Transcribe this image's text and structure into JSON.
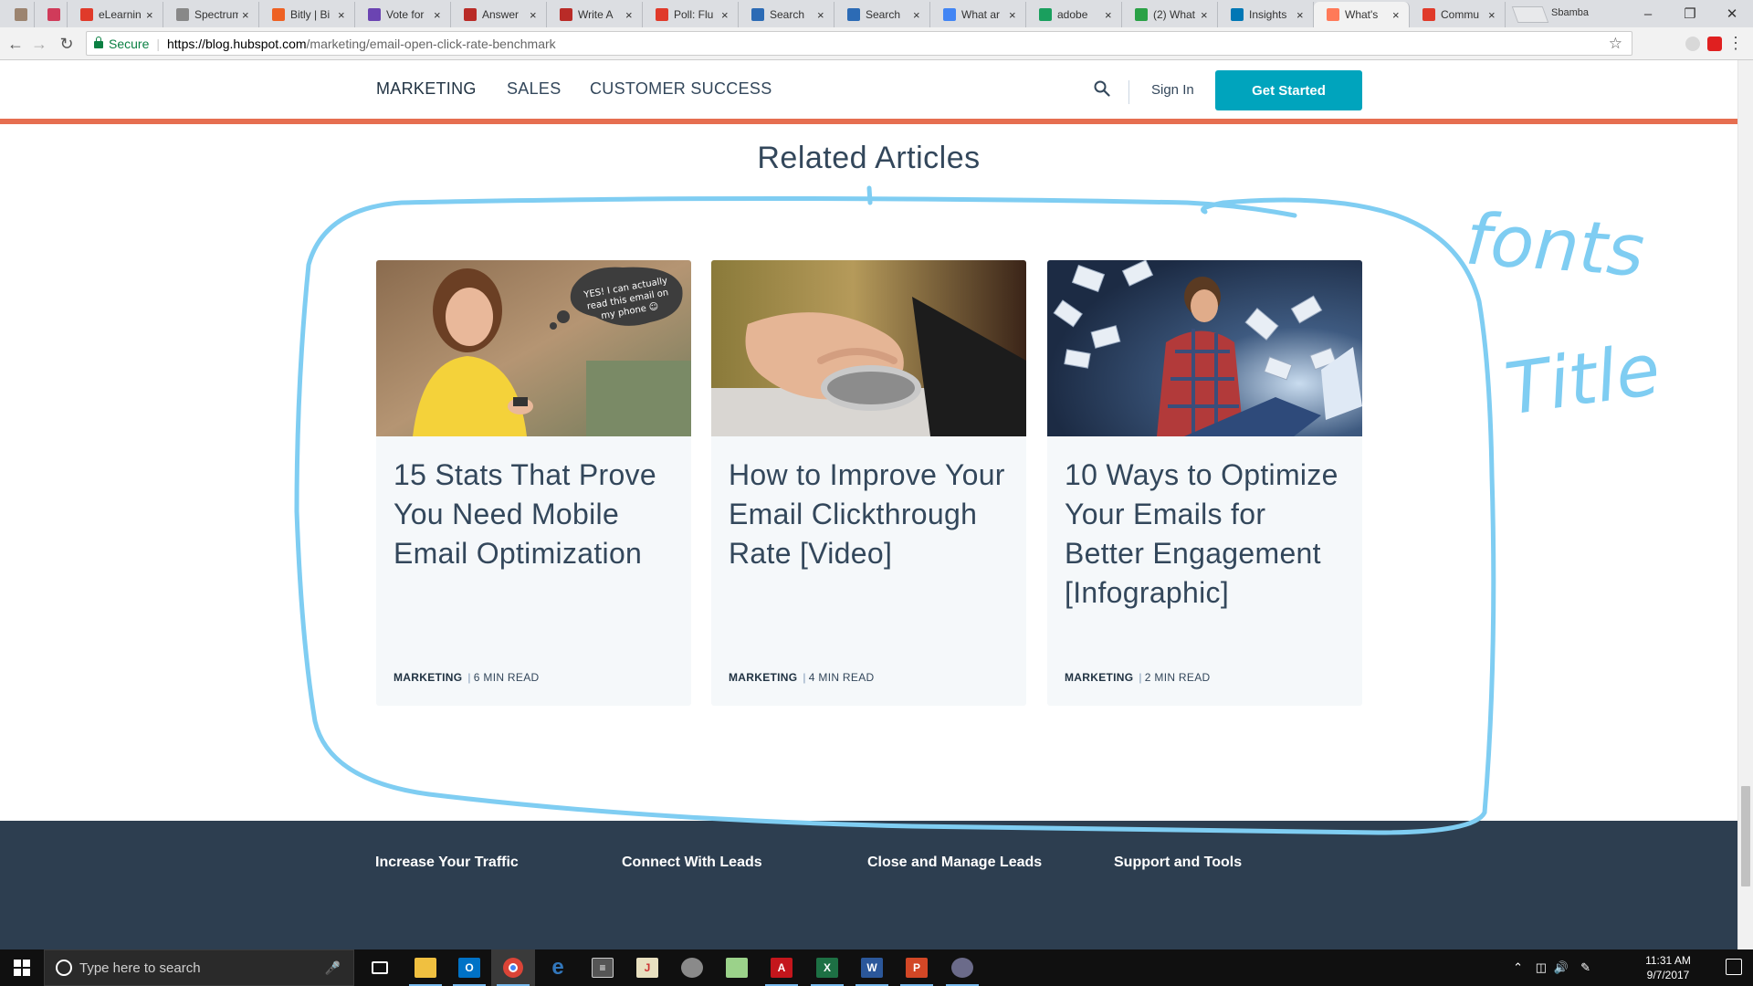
{
  "browser": {
    "tabs": [
      {
        "title": "",
        "favicon_color": "#9c8470"
      },
      {
        "title": "",
        "favicon_color": "#d03b5a"
      },
      {
        "title": "eLearnin",
        "favicon_color": "#e03a2a"
      },
      {
        "title": "Spectrum",
        "favicon_color": "#888888"
      },
      {
        "title": "Bitly | Bi",
        "favicon_color": "#ee6123"
      },
      {
        "title": "Vote for",
        "favicon_color": "#6b44b2"
      },
      {
        "title": "Answer",
        "favicon_color": "#b92b27"
      },
      {
        "title": "Write A",
        "favicon_color": "#b92b27"
      },
      {
        "title": "Poll: Flu",
        "favicon_color": "#e03a2a"
      },
      {
        "title": "Search",
        "favicon_color": "#2c6bb5"
      },
      {
        "title": "Search",
        "favicon_color": "#2c6bb5"
      },
      {
        "title": "What ar",
        "favicon_color": "#4285f4"
      },
      {
        "title": "adobe",
        "favicon_color": "#1a9f5e"
      },
      {
        "title": "(2) What",
        "favicon_color": "#2aa146"
      },
      {
        "title": "Insights",
        "favicon_color": "#0077b5"
      },
      {
        "title": "What's",
        "favicon_color": "#ff7a59"
      },
      {
        "title": "Commu",
        "favicon_color": "#e03a2a"
      }
    ],
    "active_tab_index": 15,
    "window_user": "Sbamba",
    "secure_label": "Secure",
    "url_domain": "https://blog.hubspot.com",
    "url_path": "/marketing/email-open-click-rate-benchmark"
  },
  "site_nav": {
    "links": [
      "MARKETING",
      "SALES",
      "CUSTOMER SUCCESS"
    ],
    "sign_in": "Sign In",
    "get_started": "Get Started",
    "accent": "#00a4bd",
    "bar_color": "#e66e50"
  },
  "related": {
    "heading": "Related Articles",
    "cards": [
      {
        "title": "15 Stats That Prove You Need Mobile Email Optimization",
        "category": "MARKETING",
        "read_time": "6 MIN READ",
        "image_caption": "YES! I can actually read this email on my phone ☺"
      },
      {
        "title": "How to Improve Your Email Clickthrough Rate [Video]",
        "category": "MARKETING",
        "read_time": "4 MIN READ"
      },
      {
        "title": "10 Ways to Optimize Your Emails for Better Engagement [Infographic]",
        "category": "MARKETING",
        "read_time": "2 MIN READ"
      }
    ]
  },
  "footer": {
    "headings": [
      "Increase Your Traffic",
      "Connect With Leads",
      "Close and Manage Leads",
      "Support and Tools"
    ],
    "bg_color": "#2d3e50"
  },
  "annotation": {
    "words": [
      "fonts",
      "Title"
    ],
    "color": "#7fcdf2"
  },
  "taskbar": {
    "search_placeholder": "Type here to search",
    "time": "11:31 AM",
    "date": "9/7/2017"
  }
}
